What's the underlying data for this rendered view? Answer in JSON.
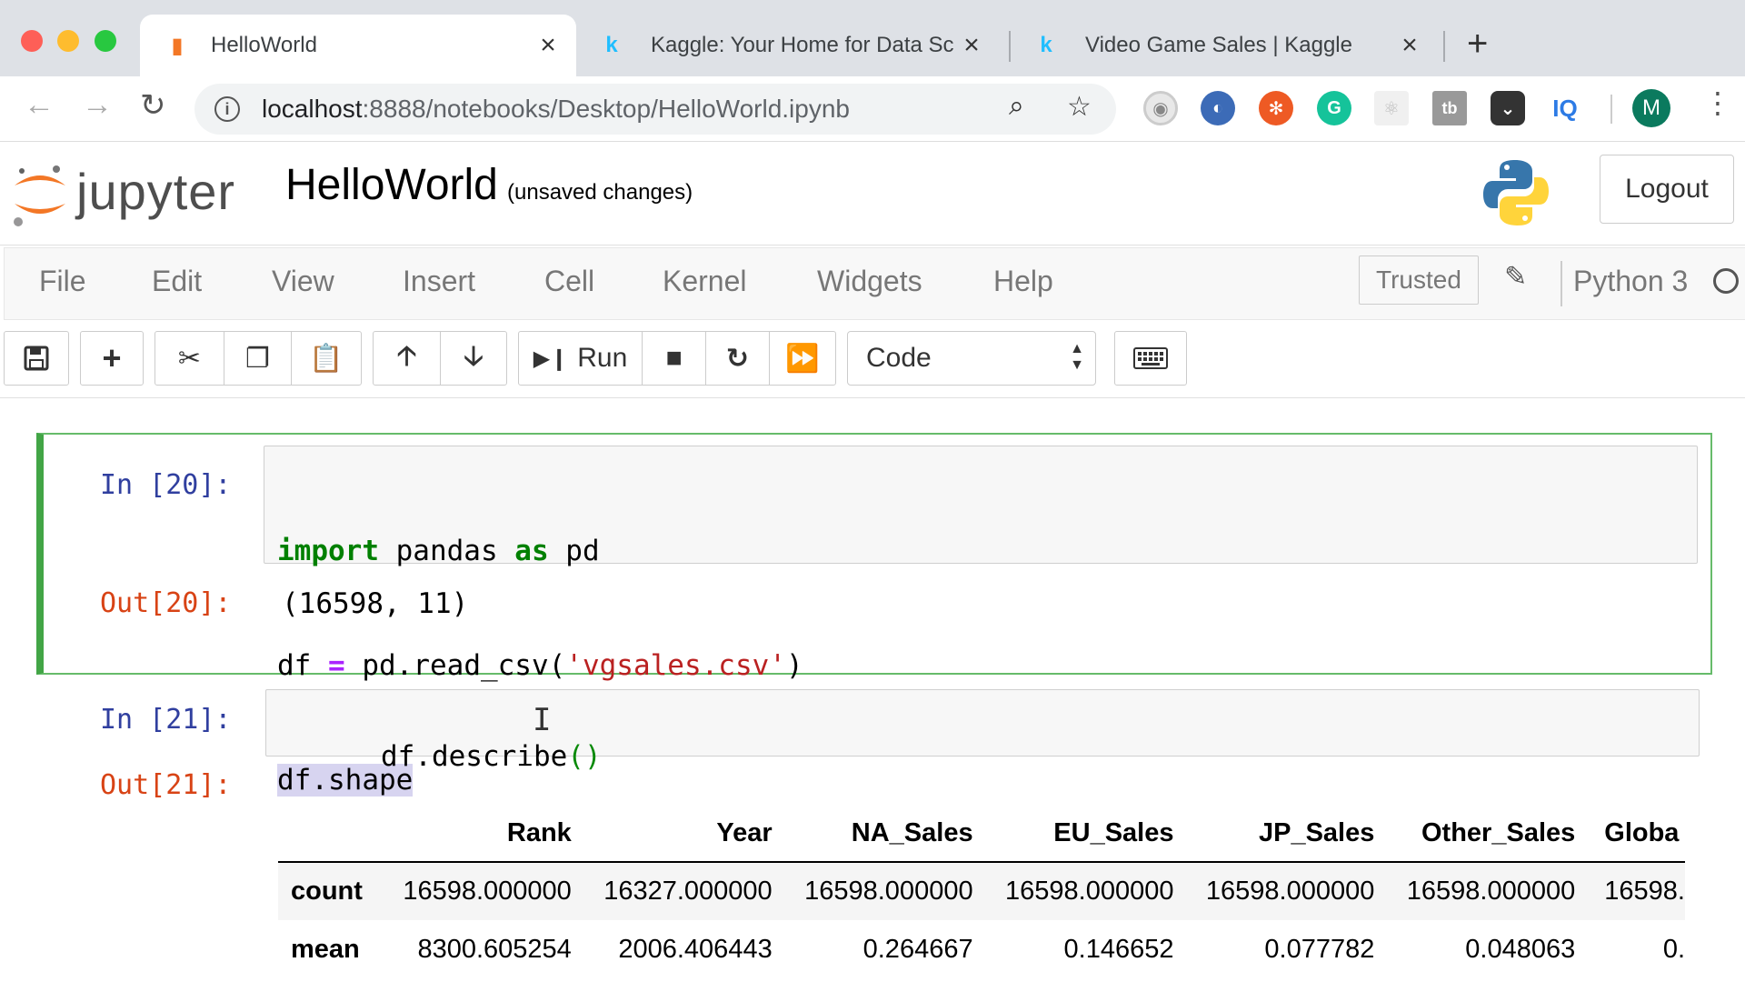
{
  "browser": {
    "tabs": [
      {
        "title": "HelloWorld",
        "favicon": "notebook-icon",
        "active": true
      },
      {
        "title": "Kaggle: Your Home for Data Sc",
        "favicon": "kaggle-k-icon",
        "active": false
      },
      {
        "title": "Video Game Sales | Kaggle",
        "favicon": "kaggle-k-icon",
        "active": false
      }
    ],
    "url_host": "localhost",
    "url_path": ":8888/notebooks/Desktop/HelloWorld.ipynb",
    "profile_initial": "M",
    "extensions": [
      "camera-extension-icon",
      "blue-circle-extension-icon",
      "orange-extension-icon",
      "grammarly-icon",
      "react-devtools-icon",
      "tb-extension-icon",
      "pocket-icon",
      "iq-extension-icon"
    ],
    "colors": {
      "tabbar": "#dee1e6",
      "profile": "#0b7a5e"
    }
  },
  "jupyter": {
    "logo_text": "jupyter",
    "notebook_name": "HelloWorld",
    "save_status": "(unsaved changes)",
    "logout_label": "Logout"
  },
  "menubar": {
    "items": [
      "File",
      "Edit",
      "View",
      "Insert",
      "Cell",
      "Kernel",
      "Widgets",
      "Help"
    ],
    "trusted_label": "Trusted",
    "kernel_name": "Python 3"
  },
  "toolbar": {
    "run_label": "Run",
    "cell_type": "Code"
  },
  "cells": [
    {
      "in_prompt": "In [20]:",
      "code_lines": [
        "import pandas as pd",
        "df = pd.read_csv('vgsales.csv')",
        "df.shape"
      ],
      "out_prompt": "Out[20]:",
      "output": "(16598, 11)"
    },
    {
      "in_prompt": "In [21]:",
      "code": "df.describe()",
      "out_prompt": "Out[21]:"
    }
  ],
  "describe_table": {
    "columns": [
      "",
      "Rank",
      "Year",
      "NA_Sales",
      "EU_Sales",
      "JP_Sales",
      "Other_Sales",
      "Globa"
    ],
    "rows": [
      {
        "label": "count",
        "values": [
          "16598.000000",
          "16327.000000",
          "16598.000000",
          "16598.000000",
          "16598.000000",
          "16598.000000",
          "16598."
        ]
      },
      {
        "label": "mean",
        "values": [
          "8300.605254",
          "2006.406443",
          "0.264667",
          "0.146652",
          "0.077782",
          "0.048063",
          "0."
        ]
      }
    ]
  }
}
